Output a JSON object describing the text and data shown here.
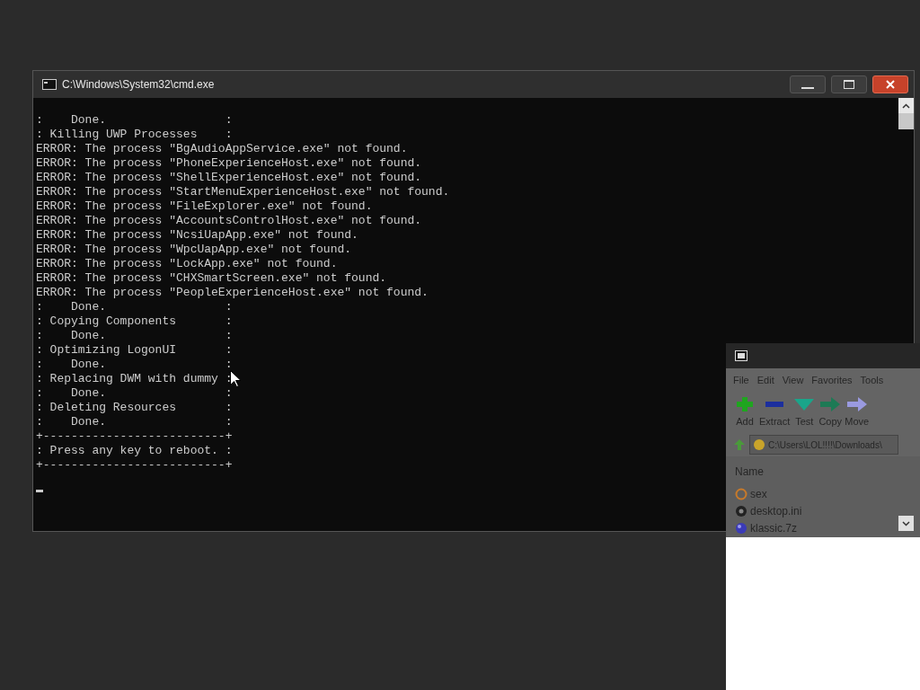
{
  "archive_window": {
    "menu": [
      "File",
      "Edit",
      "View",
      "Favorites",
      "Tools"
    ],
    "toolbar": [
      {
        "label": "Add",
        "kind": "add"
      },
      {
        "label": "Extract",
        "kind": "extract"
      },
      {
        "label": "Test",
        "kind": "test"
      },
      {
        "label": "Copy",
        "kind": "copy"
      },
      {
        "label": "Move",
        "kind": "move"
      }
    ],
    "address": "C:\\Users\\LOL!!!!\\Downloads\\",
    "list_header": "Name",
    "files": [
      {
        "name": "sex",
        "kind": "unknown"
      },
      {
        "name": "desktop.ini",
        "kind": "settings"
      },
      {
        "name": "klassic.7z",
        "kind": "archive"
      }
    ]
  },
  "cmd_window": {
    "title": "C:\\Windows\\System32\\cmd.exe",
    "lines": [
      ":    Done.                 :",
      ": Killing UWP Processes    :",
      "ERROR: The process \"BgAudioAppService.exe\" not found.",
      "ERROR: The process \"PhoneExperienceHost.exe\" not found.",
      "ERROR: The process \"ShellExperienceHost.exe\" not found.",
      "ERROR: The process \"StartMenuExperienceHost.exe\" not found.",
      "ERROR: The process \"FileExplorer.exe\" not found.",
      "ERROR: The process \"AccountsControlHost.exe\" not found.",
      "ERROR: The process \"NcsiUapApp.exe\" not found.",
      "ERROR: The process \"WpcUapApp.exe\" not found.",
      "ERROR: The process \"LockApp.exe\" not found.",
      "ERROR: The process \"CHXSmartScreen.exe\" not found.",
      "ERROR: The process \"PeopleExperienceHost.exe\" not found.",
      ":    Done.                 :",
      ": Copying Components       :",
      ":    Done.                 :",
      ": Optimizing LogonUI       :",
      ":    Done.                 :",
      ": Replacing DWM with dummy :",
      ":    Done.                 :",
      ": Deleting Resources       :",
      ":    Done.                 :",
      "+--------------------------+",
      ": Press any key to reboot. :",
      "+--------------------------+"
    ]
  }
}
